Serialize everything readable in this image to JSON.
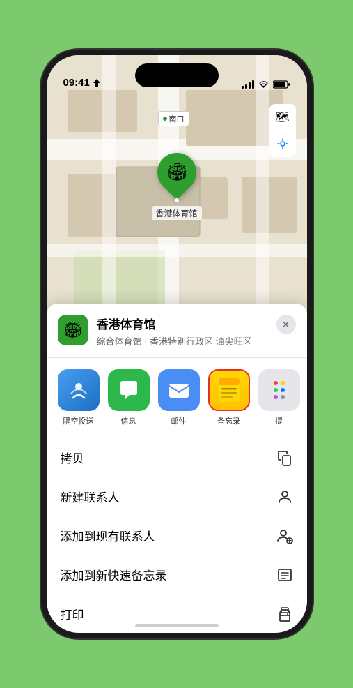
{
  "status_bar": {
    "time": "09:41",
    "location_arrow": "▶"
  },
  "map": {
    "label": "南口",
    "controls": {
      "map_icon": "🗺",
      "location_icon": "◎"
    }
  },
  "location_pin": {
    "label": "香港体育馆",
    "emoji": "🏟"
  },
  "venue_card": {
    "name": "香港体育馆",
    "subtitle": "综合体育馆 · 香港特别行政区 油尖旺区",
    "icon_emoji": "🏟"
  },
  "share_items": [
    {
      "id": "airdrop",
      "label": "隔空投送"
    },
    {
      "id": "messages",
      "label": "信息"
    },
    {
      "id": "mail",
      "label": "邮件"
    },
    {
      "id": "notes",
      "label": "备忘录"
    },
    {
      "id": "more",
      "label": "提"
    }
  ],
  "actions": [
    {
      "label": "拷贝",
      "icon": "copy"
    },
    {
      "label": "新建联系人",
      "icon": "person"
    },
    {
      "label": "添加到现有联系人",
      "icon": "person-add"
    },
    {
      "label": "添加到新快速备忘录",
      "icon": "memo"
    },
    {
      "label": "打印",
      "icon": "print"
    }
  ]
}
